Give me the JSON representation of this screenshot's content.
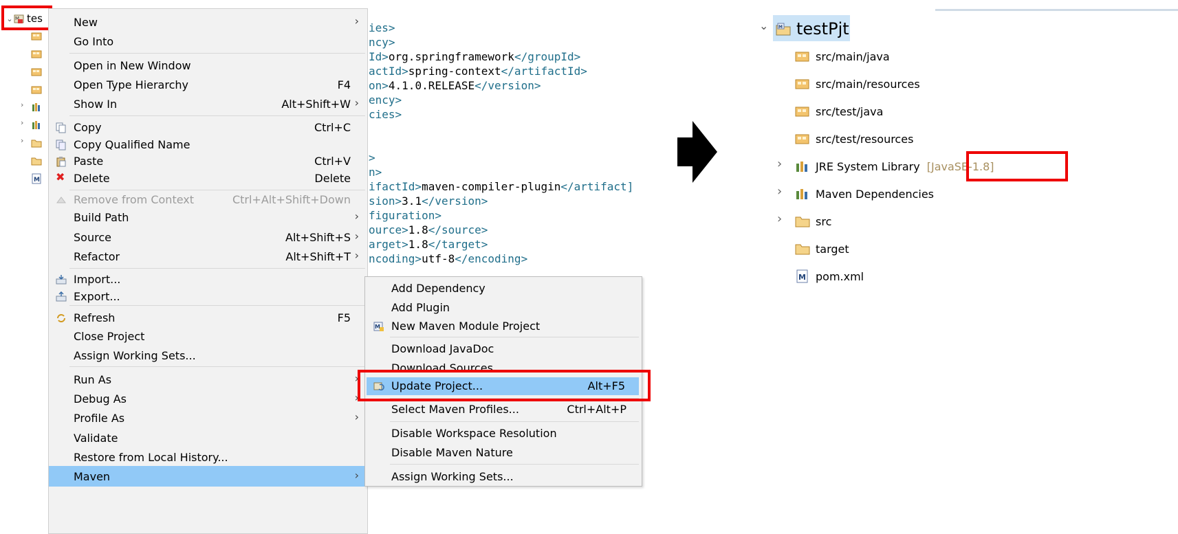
{
  "left_tree": {
    "root_label": "tes"
  },
  "editor": {
    "lines": [
      {
        "t": "ies>",
        "k": "tag"
      },
      {
        "t": "ncy>",
        "k": "tag"
      },
      {
        "pre": "Id>",
        "mid": "org.springframework",
        "post": "</groupId>"
      },
      {
        "pre": "actId>",
        "mid": "spring-context",
        "post": "</artifactId>"
      },
      {
        "pre": "on>",
        "mid": "4.1.0.RELEASE",
        "post": "</version>"
      },
      {
        "t": "ency>",
        "k": "tag"
      },
      {
        "t": "cies>",
        "k": "tag"
      },
      {
        "t": ">",
        "k": "tag"
      },
      {
        "t": "n>",
        "k": "tag"
      },
      {
        "pre": "ifactId>",
        "mid": "maven-compiler-plugin",
        "post": "</artifact]"
      },
      {
        "pre": "sion>",
        "mid": "3.1",
        "post": "</version>"
      },
      {
        "t": "figuration>",
        "k": "tag"
      },
      {
        "pre": "ource>",
        "mid": "1.8",
        "post": "</source>"
      },
      {
        "pre": "arget>",
        "mid": "1.8",
        "post": "</target>"
      },
      {
        "pre": "ncoding>",
        "mid": "utf-8",
        "post": "</encoding>"
      }
    ]
  },
  "context_menu": {
    "new": "New",
    "go_into": "Go Into",
    "open_new_window": "Open in New Window",
    "open_type_hierarchy": "Open Type Hierarchy",
    "open_type_hierarchy_sc": "F4",
    "show_in": "Show In",
    "show_in_sc": "Alt+Shift+W",
    "copy": "Copy",
    "copy_sc": "Ctrl+C",
    "copy_qualified": "Copy Qualified Name",
    "paste": "Paste",
    "paste_sc": "Ctrl+V",
    "delete": "Delete",
    "delete_sc": "Delete",
    "remove_context": "Remove from Context",
    "remove_context_sc": "Ctrl+Alt+Shift+Down",
    "build_path": "Build Path",
    "source": "Source",
    "source_sc": "Alt+Shift+S",
    "refactor": "Refactor",
    "refactor_sc": "Alt+Shift+T",
    "import": "Import...",
    "export": "Export...",
    "refresh": "Refresh",
    "refresh_sc": "F5",
    "close_project": "Close Project",
    "assign_working_sets": "Assign Working Sets...",
    "run_as": "Run As",
    "debug_as": "Debug As",
    "profile_as": "Profile As",
    "validate": "Validate",
    "restore_history": "Restore from Local History...",
    "maven": "Maven"
  },
  "maven_submenu": {
    "add_dependency": "Add Dependency",
    "add_plugin": "Add Plugin",
    "new_module": "New Maven Module Project",
    "download_javadoc": "Download JavaDoc",
    "download_sources": "Download Sources",
    "update_project": "Update Project...",
    "update_project_sc": "Alt+F5",
    "select_profiles": "Select Maven Profiles...",
    "select_profiles_sc": "Ctrl+Alt+P",
    "disable_ws": "Disable Workspace Resolution",
    "disable_nature": "Disable Maven Nature",
    "assign_ws": "Assign Working Sets..."
  },
  "right_tree": {
    "project": "testPjt",
    "src_main_java": "src/main/java",
    "src_main_resources": "src/main/resources",
    "src_test_java": "src/test/java",
    "src_test_resources": "src/test/resources",
    "jre_lib": "JRE System Library",
    "jre_version": "[JavaSE-1.8]",
    "maven_deps": "Maven Dependencies",
    "src": "src",
    "target": "target",
    "pom": "pom.xml"
  },
  "colors": {
    "highlight": "#91c9f7",
    "annotation_red": "#ee0000",
    "xml_tag": "#1f6e8a",
    "decorator": "#a89060"
  },
  "icons": [
    "package-folder-icon",
    "library-icon",
    "folder-icon",
    "maven-pom-icon",
    "maven-project-icon",
    "copy-icon",
    "paste-icon",
    "delete-icon",
    "import-icon",
    "export-icon",
    "refresh-icon",
    "update-icon",
    "new-module-icon",
    "right-arrow-icon"
  ]
}
